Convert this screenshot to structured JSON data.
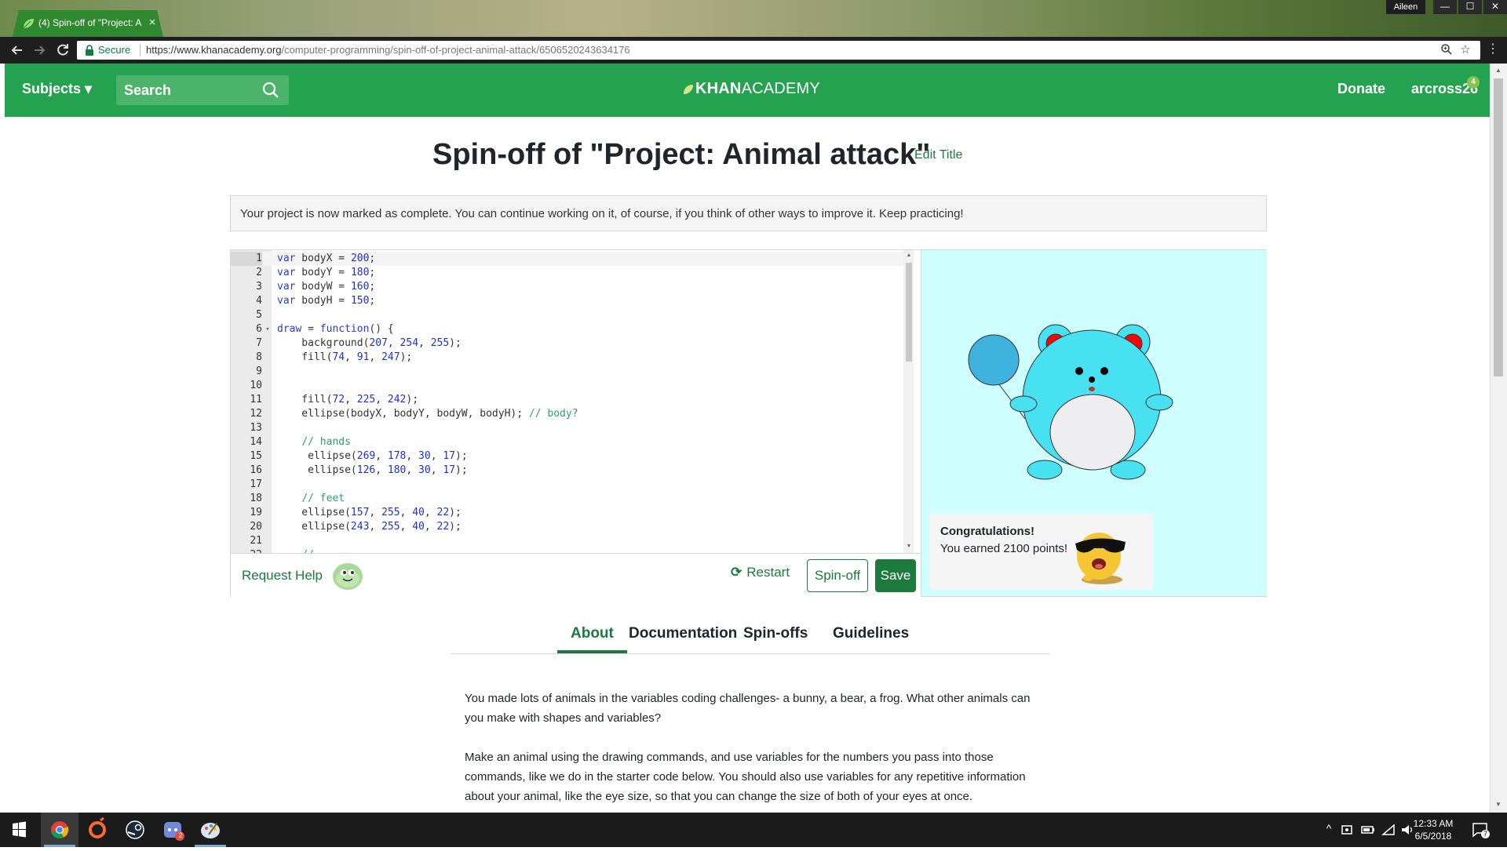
{
  "browser": {
    "tab_title": "(4) Spin-off of \"Project: A",
    "close_glyph": "×",
    "user_badge": "Aileen",
    "window_buttons": [
      "—",
      "☐",
      "✕"
    ],
    "secure_label": "Secure",
    "url_host": "https://www.khanacademy.org",
    "url_path": "/computer-programming/spin-off-of-project-animal-attack/6506520243634176",
    "menu_glyph": "⋮",
    "icons": [
      "back-arrow-icon",
      "forward-arrow-icon",
      "reload-icon",
      "lock-icon",
      "zoom-icon",
      "bookmark-star-icon"
    ]
  },
  "nav": {
    "subjects": "Subjects ▾",
    "search_label": "Search",
    "logo_bold": "KHAN",
    "logo_light": "ACADEMY",
    "donate": "Donate",
    "username": "arcross26",
    "notification_count": "4",
    "brand_color": "#25a24f"
  },
  "project": {
    "title": "Spin-off of \"Project: Animal attack\"",
    "edit_title": "Edit Title",
    "notice": "Your project is now marked as complete. You can continue working on it, of course, if you think of other ways to improve it. Keep practicing!"
  },
  "editor": {
    "lines": [
      {
        "n": "1",
        "html": "<span class=\"kw\">var</span> bodyX = <span class=\"n\">200</span>;"
      },
      {
        "n": "2",
        "html": "<span class=\"kw\">var</span> bodyY = <span class=\"n\">180</span>;"
      },
      {
        "n": "3",
        "html": "<span class=\"kw\">var</span> bodyW = <span class=\"n\">160</span>;"
      },
      {
        "n": "4",
        "html": "<span class=\"kw\">var</span> bodyH = <span class=\"n\">150</span>;"
      },
      {
        "n": "5",
        "html": ""
      },
      {
        "n": "6",
        "fold": "▾",
        "html": "<span class=\"kw\">draw</span> = <span class=\"kw\">function</span>() {"
      },
      {
        "n": "7",
        "html": "    background(<span class=\"n\">207</span>, <span class=\"n\">254</span>, <span class=\"n\">255</span>);"
      },
      {
        "n": "8",
        "html": "    fill(<span class=\"n\">74</span>, <span class=\"n\">91</span>, <span class=\"n\">247</span>);"
      },
      {
        "n": "9",
        "html": ""
      },
      {
        "n": "10",
        "html": ""
      },
      {
        "n": "11",
        "html": "    fill(<span class=\"n\">72</span>, <span class=\"n\">225</span>, <span class=\"n\">242</span>);"
      },
      {
        "n": "12",
        "html": "    ellipse(bodyX, bodyY, bodyW, bodyH); <span class=\"cm\">// body?</span>"
      },
      {
        "n": "13",
        "html": ""
      },
      {
        "n": "14",
        "html": "    <span class=\"cm\">// hands</span>"
      },
      {
        "n": "15",
        "html": "     ellipse(<span class=\"n\">269</span>, <span class=\"n\">178</span>, <span class=\"n\">30</span>, <span class=\"n\">17</span>);"
      },
      {
        "n": "16",
        "html": "     ellipse(<span class=\"n\">126</span>, <span class=\"n\">180</span>, <span class=\"n\">30</span>, <span class=\"n\">17</span>);"
      },
      {
        "n": "17",
        "html": ""
      },
      {
        "n": "18",
        "html": "    <span class=\"cm\">// feet</span>"
      },
      {
        "n": "19",
        "html": "    ellipse(<span class=\"n\">157</span>, <span class=\"n\">255</span>, <span class=\"n\">40</span>, <span class=\"n\">22</span>);"
      },
      {
        "n": "20",
        "html": "    ellipse(<span class=\"n\">243</span>, <span class=\"n\">255</span>, <span class=\"n\">40</span>, <span class=\"n\">22</span>);"
      },
      {
        "n": "21",
        "html": ""
      },
      {
        "n": "22",
        "html": "    <span class=\"cm\">//</span>"
      }
    ],
    "request_help": "Request Help",
    "restart": "Restart",
    "restart_glyph": "⟳",
    "spinoff": "Spin-off",
    "save": "Save"
  },
  "output": {
    "background_color": "#cffeff",
    "congrats_title": "Congratulations!",
    "congrats_text": "You earned 2100 points!"
  },
  "tabs": [
    {
      "label": "About",
      "active": true
    },
    {
      "label": "Documentation",
      "active": false
    },
    {
      "label": "Spin-offs",
      "active": false
    },
    {
      "label": "Guidelines",
      "active": false
    }
  ],
  "about": {
    "para1": "You made lots of animals in the variables coding challenges- a bunny, a bear, a frog. What other animals can you make with shapes and variables?",
    "para2": "Make an animal using the drawing commands, and use variables for the numbers you pass into those commands, like we do in the starter code below. You should also use variables for any repetitive information about your animal, like the eye size, so that you can change the size of both of your eyes at once."
  },
  "taskbar": {
    "apps": [
      "windows-start-icon",
      "chrome-icon",
      "origin-icon",
      "steam-icon",
      "discord-icon",
      "paint-icon"
    ],
    "discord_badge": "2",
    "time": "12:33 AM",
    "date": "6/5/2018",
    "notification_badge": "7",
    "tray_up_glyph": "^"
  }
}
